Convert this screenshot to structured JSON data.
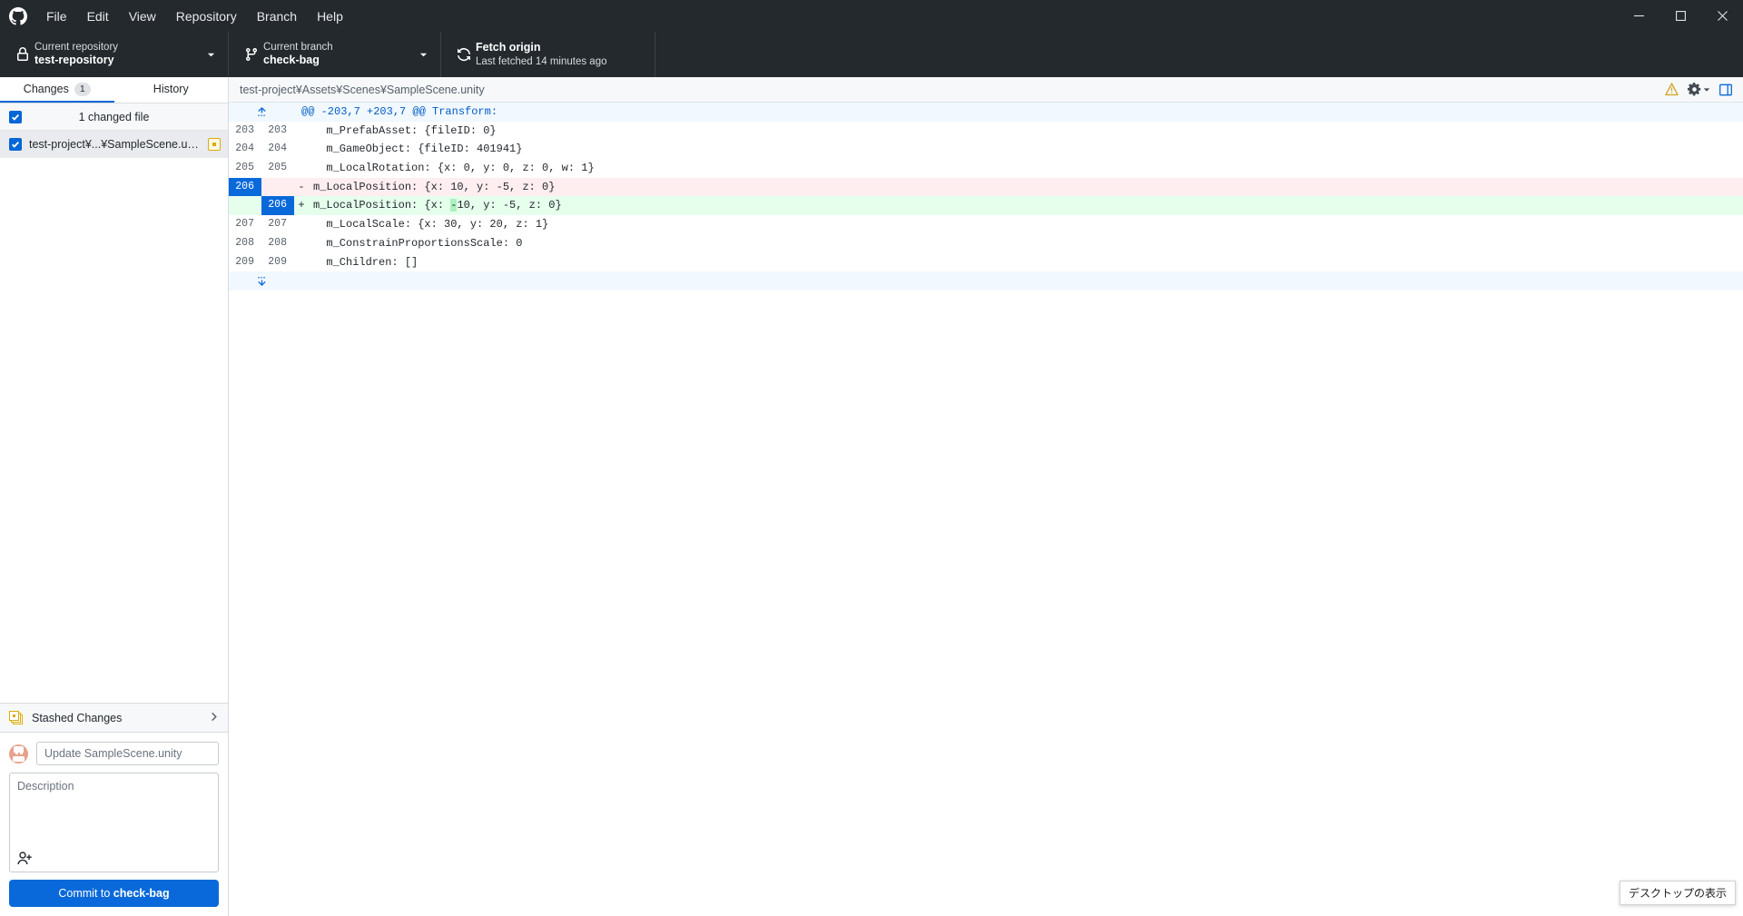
{
  "titlebar": {
    "logo_icon": "github-mark-icon",
    "menu": [
      {
        "label": "File"
      },
      {
        "label": "Edit"
      },
      {
        "label": "View"
      },
      {
        "label": "Repository"
      },
      {
        "label": "Branch"
      },
      {
        "label": "Help"
      }
    ],
    "window_controls": [
      {
        "name": "minimize",
        "icon": "minimize-icon"
      },
      {
        "name": "maximize",
        "icon": "maximize-icon"
      },
      {
        "name": "close",
        "icon": "close-icon"
      }
    ]
  },
  "toolbar": {
    "repository": {
      "icon": "lock-icon",
      "label": "Current repository",
      "value": "test-repository",
      "caret": "chevron-down-icon"
    },
    "branch": {
      "icon": "branch-icon",
      "label": "Current branch",
      "value": "check-bag",
      "caret": "chevron-down-icon"
    },
    "fetch": {
      "icon": "sync-icon",
      "label": "Fetch origin",
      "value": "Last fetched 14 minutes ago"
    }
  },
  "sidebar": {
    "tabs": [
      {
        "label": "Changes",
        "badge": "1",
        "active": true
      },
      {
        "label": "History",
        "badge": "",
        "active": false
      }
    ],
    "changed_header": {
      "label": "1 changed file",
      "checked": true
    },
    "files": [
      {
        "name": "test-project¥...¥SampleScene.unity",
        "checked": true,
        "status": "modified",
        "status_icon": "modified-status-icon"
      }
    ],
    "stashed": {
      "label": "Stashed Changes",
      "icon": "stash-icon",
      "chevron": "chevron-right-icon"
    },
    "commit": {
      "avatar_icon": "user-avatar",
      "summary_placeholder": "Update SampleScene.unity",
      "summary_value": "",
      "description_placeholder": "Description",
      "description_value": "",
      "coauthor_icon": "add-person-icon",
      "button_prefix": "Commit to ",
      "button_branch": "check-bag"
    }
  },
  "diff_panel": {
    "path": "test-project¥Assets¥Scenes¥SampleScene.unity",
    "icons": {
      "warning": "warning-triangle-icon",
      "gear": "gear-icon",
      "gear_caret": "chevron-down-icon",
      "expand": "expand-panel-icon"
    },
    "hunk_header": "@@ -203,7 +203,7 @@ Transform:",
    "expand_up_icon": "expand-up-icon",
    "expand_down_icon": "expand-down-icon",
    "lines": [
      {
        "type": "context",
        "old": "203",
        "new": "203",
        "mark": "",
        "text": "  m_PrefabAsset: {fileID: 0}"
      },
      {
        "type": "context",
        "old": "204",
        "new": "204",
        "mark": "",
        "text": "  m_GameObject: {fileID: 401941}"
      },
      {
        "type": "context",
        "old": "205",
        "new": "205",
        "mark": "",
        "text": "  m_LocalRotation: {x: 0, y: 0, z: 0, w: 1}"
      },
      {
        "type": "deletion",
        "old": "206",
        "new": "",
        "mark": "-",
        "pre": "m_LocalPosition: {x: ",
        "hl": "",
        "post": "10, y: -5, z: 0}"
      },
      {
        "type": "addition",
        "old": "",
        "new": "206",
        "mark": "+",
        "pre": "m_LocalPosition: {x: ",
        "hl": "-",
        "post": "10, y: -5, z: 0}"
      },
      {
        "type": "context",
        "old": "207",
        "new": "207",
        "mark": "",
        "text": "  m_LocalScale: {x: 30, y: 20, z: 1}"
      },
      {
        "type": "context",
        "old": "208",
        "new": "208",
        "mark": "",
        "text": "  m_ConstrainProportionsScale: 0"
      },
      {
        "type": "context",
        "old": "209",
        "new": "209",
        "mark": "",
        "text": "  m_Children: []"
      }
    ]
  },
  "taskbar": {
    "show_desktop_tooltip": "デスクトップの表示"
  },
  "colors": {
    "accent": "#0969da",
    "toolbar_bg": "#24292e",
    "addition_bg": "#e6ffed",
    "deletion_bg": "#ffeef0",
    "addition_hl": "#acf2bd",
    "deletion_hl": "#fdb8c0",
    "status_modified": "#dbab09"
  }
}
